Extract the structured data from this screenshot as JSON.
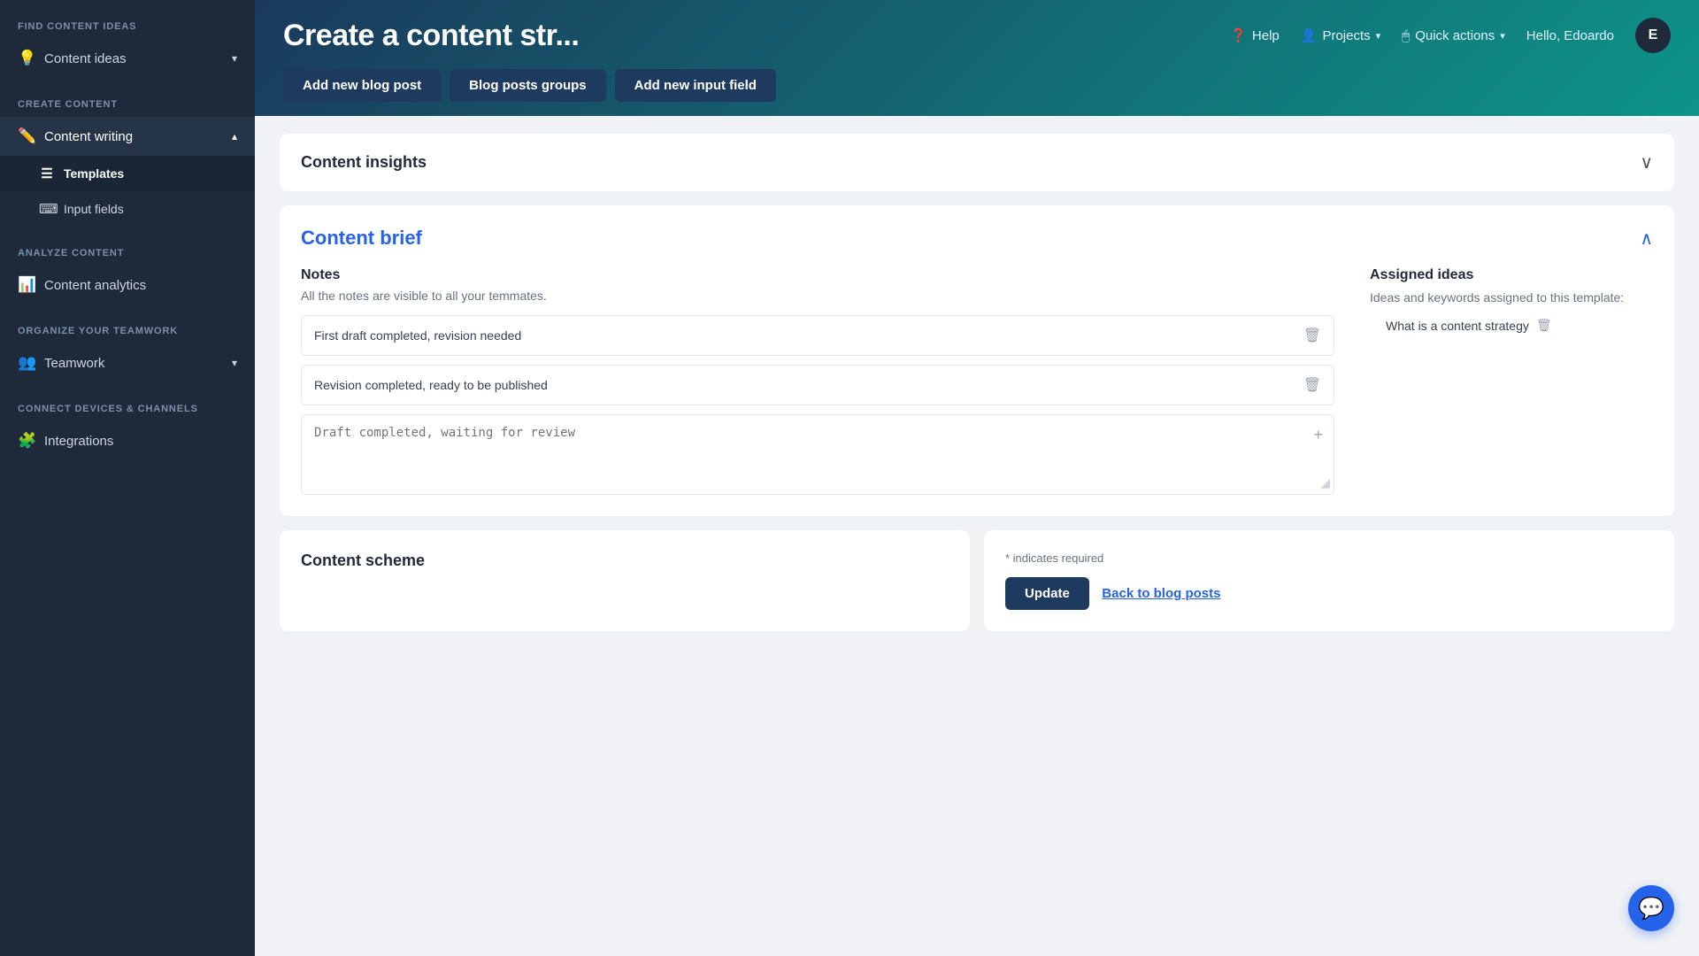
{
  "sidebar": {
    "sections": [
      {
        "label": "Find Content Ideas",
        "items": [
          {
            "id": "content-ideas",
            "icon": "💡",
            "label": "Content ideas",
            "hasChevron": true,
            "active": false
          }
        ]
      },
      {
        "label": "Create Content",
        "items": [
          {
            "id": "content-writing",
            "icon": "✏️",
            "label": "Content writing",
            "hasChevron": true,
            "active": true,
            "subItems": [
              {
                "id": "templates",
                "icon": "☰",
                "label": "Templates",
                "active": true
              },
              {
                "id": "input-fields",
                "icon": "⌨",
                "label": "Input fields",
                "active": false
              }
            ]
          }
        ]
      },
      {
        "label": "Analyze Content",
        "items": [
          {
            "id": "content-analytics",
            "icon": "📊",
            "label": "Content analytics",
            "hasChevron": false,
            "active": false
          }
        ]
      },
      {
        "label": "Organize Your Teamwork",
        "items": [
          {
            "id": "teamwork",
            "icon": "👥",
            "label": "Teamwork",
            "hasChevron": true,
            "active": false
          }
        ]
      },
      {
        "label": "Connect Devices & Channels",
        "items": [
          {
            "id": "integrations",
            "icon": "🧩",
            "label": "Integrations",
            "hasChevron": false,
            "active": false
          }
        ]
      }
    ]
  },
  "header": {
    "title": "Create a content str...",
    "nav": [
      {
        "id": "help",
        "icon": "❓",
        "label": "Help",
        "hasChevron": false
      },
      {
        "id": "projects",
        "icon": "👤",
        "label": "Projects",
        "hasChevron": true
      },
      {
        "id": "quick-actions",
        "icon": "🖱",
        "label": "Quick actions",
        "hasChevron": true
      }
    ],
    "greeting": "Hello, Edoardo",
    "avatar_letter": "E",
    "buttons": [
      {
        "id": "add-new-blog-post",
        "label": "Add new blog post"
      },
      {
        "id": "blog-posts-groups",
        "label": "Blog posts groups"
      },
      {
        "id": "add-new-input-field",
        "label": "Add new input field"
      }
    ]
  },
  "main": {
    "content_insights": {
      "title": "Content insights"
    },
    "content_brief": {
      "title": "Content brief",
      "notes_section": {
        "title": "Notes",
        "subtitle": "All the notes are visible to all your temmates.",
        "notes": [
          {
            "id": "note-1",
            "text": "First draft completed, revision needed"
          },
          {
            "id": "note-2",
            "text": "Revision completed, ready to be published"
          }
        ],
        "textarea_placeholder": "Draft completed, waiting for review"
      },
      "assigned_ideas_section": {
        "title": "Assigned ideas",
        "description": "Ideas and keywords assigned to this template:",
        "ideas": [
          {
            "id": "idea-1",
            "text": "What is a content strategy"
          }
        ]
      }
    },
    "content_scheme": {
      "title": "Content scheme"
    },
    "required_section": {
      "required_text": "* indicates required",
      "update_button": "Update",
      "back_button": "Back to blog posts"
    }
  },
  "chat": {
    "icon": "💬"
  }
}
